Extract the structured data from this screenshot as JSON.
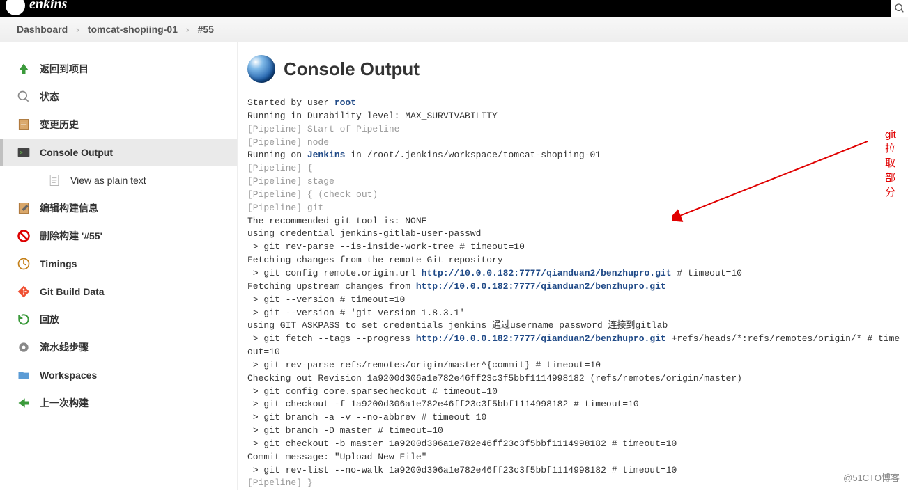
{
  "header": {
    "app_name": "enkins"
  },
  "breadcrumb": {
    "items": [
      "Dashboard",
      "tomcat-shopiing-01",
      "#55"
    ]
  },
  "sidebar": {
    "items": [
      {
        "label": "返回到项目"
      },
      {
        "label": "状态"
      },
      {
        "label": "变更历史"
      },
      {
        "label": "Console Output"
      },
      {
        "label": "View as plain text"
      },
      {
        "label": "编辑构建信息"
      },
      {
        "label": "删除构建 '#55'"
      },
      {
        "label": "Timings"
      },
      {
        "label": "Git Build Data"
      },
      {
        "label": "回放"
      },
      {
        "label": "流水线步骤"
      },
      {
        "label": "Workspaces"
      },
      {
        "label": "上一次构建"
      }
    ]
  },
  "page": {
    "title": "Console Output"
  },
  "annotation": {
    "label": "git拉取部分"
  },
  "console": {
    "started_by": "Started by user ",
    "user": "root",
    "durability": "Running in Durability level: MAX_SURVIVABILITY",
    "p_start": "[Pipeline] Start of Pipeline",
    "p_node": "[Pipeline] node",
    "running_on_pre": "Running on ",
    "running_on_node": "Jenkins",
    "running_on_post": " in /root/.jenkins/workspace/tomcat-shopiing-01",
    "p_brace_open": "[Pipeline] {",
    "p_stage": "[Pipeline] stage",
    "p_checkout": "[Pipeline] { (check out)",
    "p_git": "[Pipeline] git",
    "git_tool": "The recommended git tool is: NONE",
    "cred": "using credential jenkins-gitlab-user-passwd",
    "rev_parse_tree": " > git rev-parse --is-inside-work-tree # timeout=10",
    "fetch_changes": "Fetching changes from the remote Git repository",
    "config_remote_pre": " > git config remote.origin.url ",
    "url1": "http://10.0.0.182:7777/qianduan2/benzhupro.git",
    "config_remote_post": " # timeout=10",
    "fetch_upstream_pre": "Fetching upstream changes from ",
    "url2": "http://10.0.0.182:7777/qianduan2/benzhupro.git",
    "git_version": " > git --version # timeout=10",
    "git_version2": " > git --version # 'git version 1.8.3.1'",
    "askpass": "using GIT_ASKPASS to set credentials jenkins 通过username password 连接到gitlab",
    "fetch_pre": " > git fetch --tags --progress ",
    "url3": "http://10.0.0.182:7777/qianduan2/benzhupro.git",
    "fetch_post": " +refs/heads/*:refs/remotes/origin/* # timeout=10",
    "rev_parse_master": " > git rev-parse refs/remotes/origin/master^{commit} # timeout=10",
    "checking_out": "Checking out Revision 1a9200d306a1e782e46ff23c3f5bbf1114998182 (refs/remotes/origin/master)",
    "sparse": " > git config core.sparsecheckout # timeout=10",
    "checkout_f": " > git checkout -f 1a9200d306a1e782e46ff23c3f5bbf1114998182 # timeout=10",
    "branch_a": " > git branch -a -v --no-abbrev # timeout=10",
    "branch_d": " > git branch -D master # timeout=10",
    "checkout_b": " > git checkout -b master 1a9200d306a1e782e46ff23c3f5bbf1114998182 # timeout=10",
    "commit_msg": "Commit message: \"Upload New File\"",
    "rev_list": " > git rev-list --no-walk 1a9200d306a1e782e46ff23c3f5bbf1114998182 # timeout=10",
    "p_brace_close": "[Pipeline] }"
  },
  "watermark": "@51CTO博客"
}
